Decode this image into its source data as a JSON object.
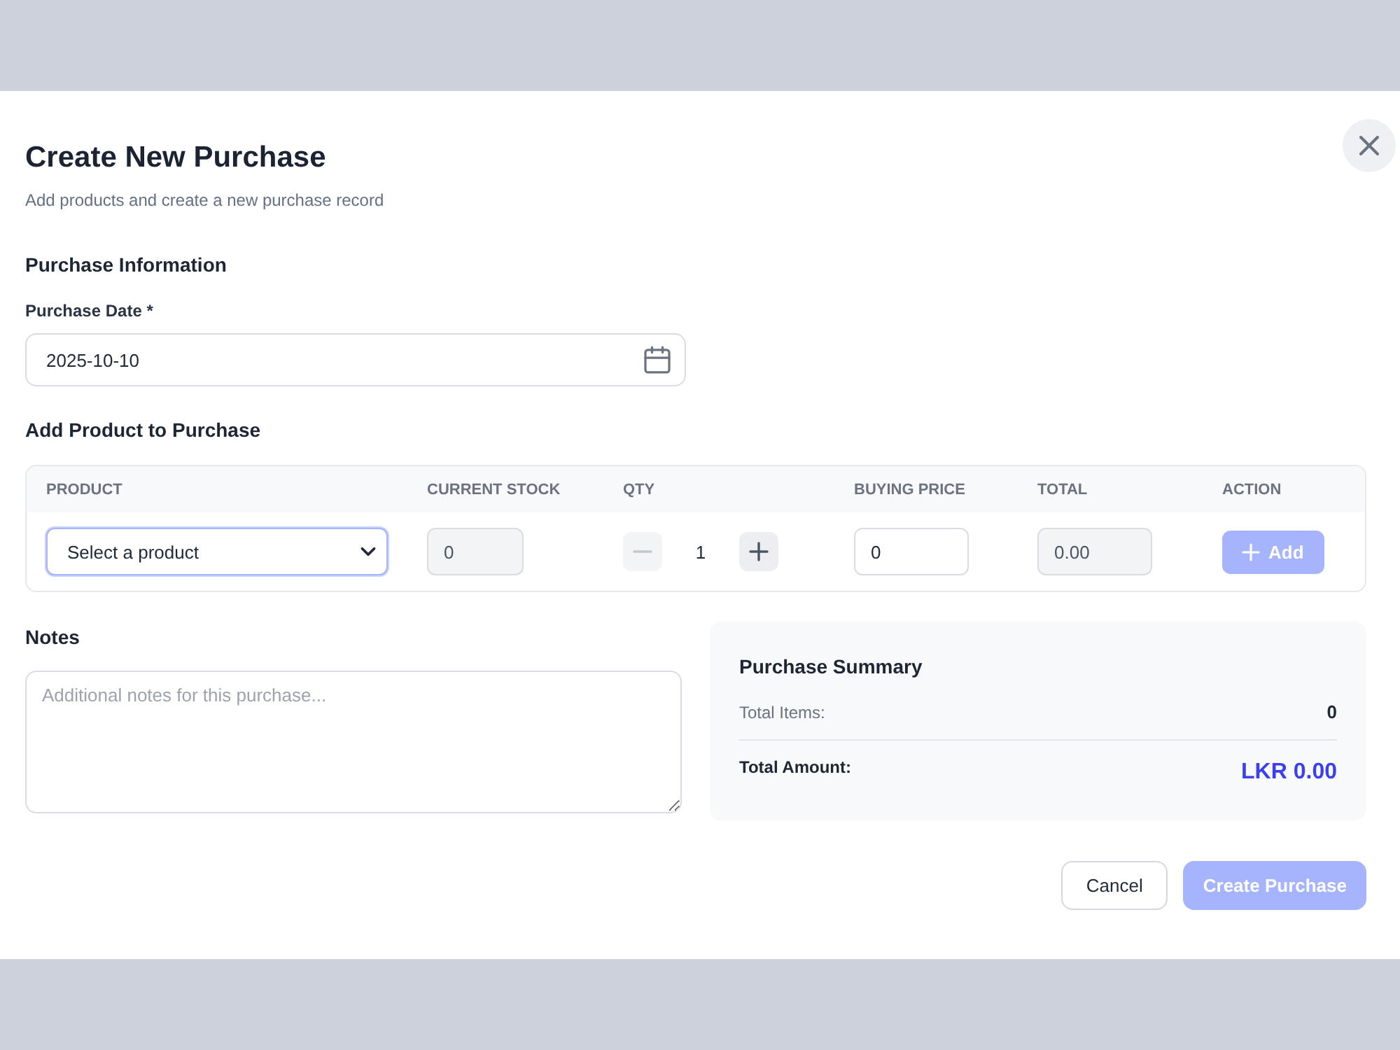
{
  "dialog": {
    "title": "Create New Purchase",
    "subtitle": "Add products and create a new purchase record"
  },
  "purchase_information": {
    "heading": "Purchase Information",
    "purchase_date": {
      "label": "Purchase Date *",
      "value": "2025-10-10"
    }
  },
  "add_product": {
    "heading": "Add Product to Purchase",
    "columns": [
      "PRODUCT",
      "CURRENT STOCK",
      "QTY",
      "BUYING PRICE",
      "TOTAL",
      "ACTION"
    ],
    "entry": {
      "product": {
        "value": "Select a product",
        "focused": true
      },
      "current_stock": {
        "value": "0",
        "disabled": true
      },
      "qty": {
        "value": "1",
        "decrease": {
          "disabled": true
        },
        "increase": {
          "disabled": false
        }
      },
      "buying_price": {
        "value": "0",
        "disabled": false
      },
      "total": {
        "value": "0.00",
        "disabled": true
      },
      "add_button": {
        "label": "Add",
        "disabled": true
      }
    }
  },
  "notes": {
    "label": "Notes",
    "placeholder": "Additional notes for this purchase..."
  },
  "summary": {
    "title": "Purchase Summary",
    "rows": [
      {
        "kind": "count",
        "label": "Total Items:",
        "value": "0"
      },
      {
        "kind": "total",
        "label": "Total Amount:",
        "value": "LKR 0.00"
      }
    ]
  },
  "footer": {
    "buttons": [
      {
        "kind": "secondary",
        "label": "Cancel",
        "disabled": false
      },
      {
        "kind": "primary",
        "label": "Create Purchase",
        "disabled": true
      }
    ]
  }
}
